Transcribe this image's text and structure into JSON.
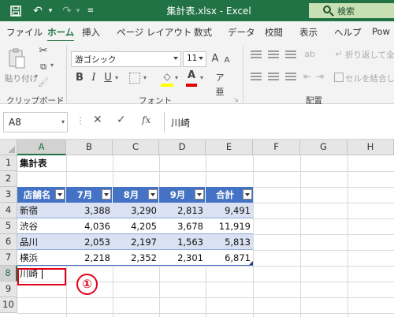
{
  "titlebar": {
    "title": "集計表.xlsx  -  Excel",
    "search_label": "検索"
  },
  "ribbon_tabs": [
    "ファイル",
    "ホーム",
    "挿入",
    "ページ レイアウト",
    "数式",
    "データ",
    "校閲",
    "表示",
    "ヘルプ",
    "Pow"
  ],
  "ribbon": {
    "paste_label": "貼り付け",
    "clipboard_label": "クリップボード",
    "font_name": "游ゴシック",
    "font_size": "11",
    "grow_font": "A",
    "shrink_font": "A",
    "bold": "B",
    "italic": "I",
    "underline": "U",
    "font_color_letter": "A",
    "font_group_label": "フォント",
    "wrap_text": "折り返して全体",
    "merge_center": "セルを結合して",
    "alignment_label": "配置"
  },
  "formula_bar": {
    "name_box": "A8",
    "fx": "fx",
    "content": "川崎"
  },
  "columns": [
    "A",
    "B",
    "C",
    "D",
    "E",
    "F",
    "G",
    "H"
  ],
  "rows": [
    "1",
    "2",
    "3",
    "4",
    "5",
    "6",
    "7",
    "8",
    "9",
    "10"
  ],
  "sheet": {
    "title": "集計表",
    "headers": [
      "店舗名",
      "7月",
      "8月",
      "9月",
      "合計"
    ],
    "data": [
      [
        "新宿",
        "3,388",
        "3,290",
        "2,813",
        "9,491"
      ],
      [
        "渋谷",
        "4,036",
        "4,205",
        "3,678",
        "11,919"
      ],
      [
        "品川",
        "2,053",
        "2,197",
        "1,563",
        "5,813"
      ],
      [
        "横浜",
        "2,218",
        "2,352",
        "2,301",
        "6,871"
      ]
    ],
    "input_cell": "川崎",
    "active_cell": "A8"
  },
  "annotation": "①",
  "colors": {
    "excel_green": "#217346",
    "table_header": "#4472c4",
    "band": "#d9e1f2",
    "highlight": "#e0001b"
  }
}
